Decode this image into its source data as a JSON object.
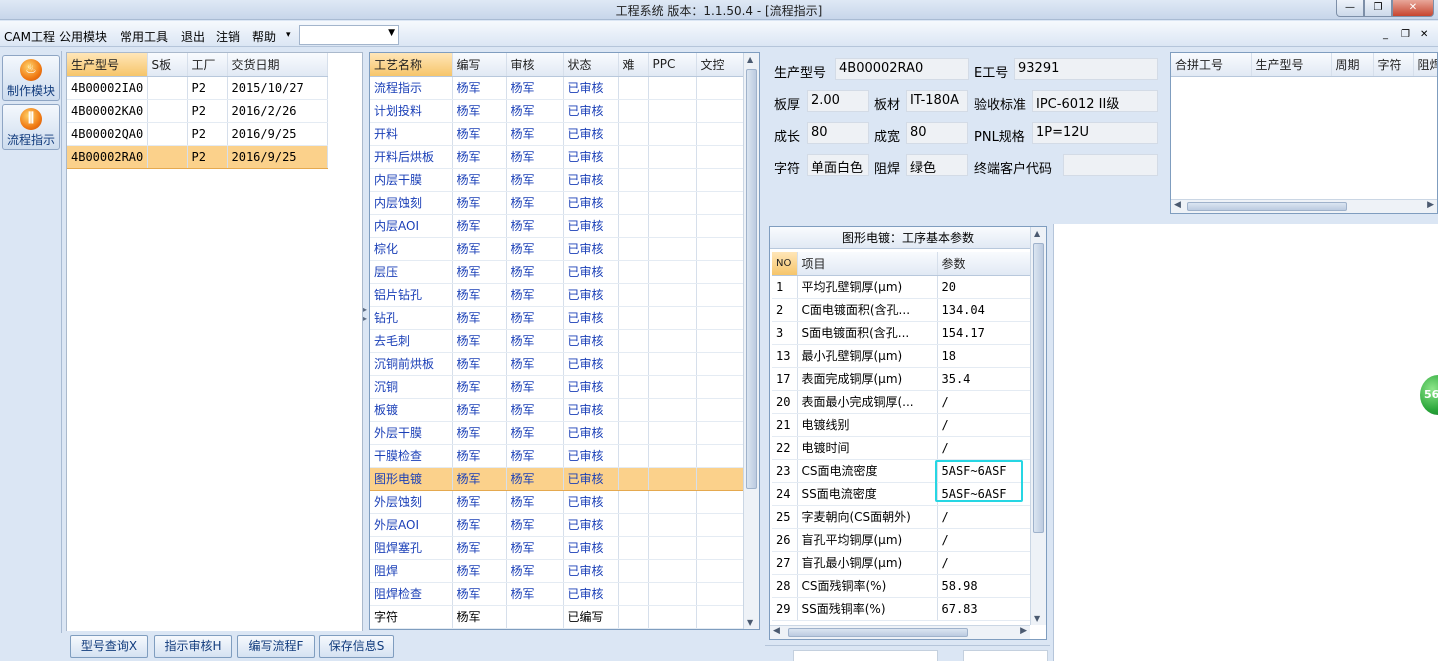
{
  "window": {
    "title": "工程系统   版本：1.1.50.4 - [流程指示]",
    "min": "—",
    "restore": "❐",
    "close": "✕"
  },
  "menu": {
    "items": [
      "CAM工程",
      "公用模块",
      "常用工具",
      "退出",
      "注销",
      "帮助"
    ],
    "combo_value": "",
    "mdi_min": "_",
    "mdi_restore": "❐",
    "mdi_close": "✕"
  },
  "nav": [
    {
      "label": "制作模块",
      "icon": "fire-icon",
      "glyph": "♨"
    },
    {
      "label": "流程指示",
      "icon": "flow-icon",
      "glyph": "⫼"
    }
  ],
  "models": {
    "headers": [
      "生产型号",
      "S板",
      "工厂",
      "交货日期"
    ],
    "rows": [
      {
        "model": "4B00002IA0",
        "s": "",
        "factory": "P2",
        "date": "2015/10/27"
      },
      {
        "model": "4B00002KA0",
        "s": "",
        "factory": "P2",
        "date": "2016/2/26"
      },
      {
        "model": "4B00002QA0",
        "s": "",
        "factory": "P2",
        "date": "2016/9/25"
      },
      {
        "model": "4B00002RA0",
        "s": "",
        "factory": "P2",
        "date": "2016/9/25"
      }
    ],
    "selected_index": 3
  },
  "process": {
    "headers": [
      "工艺名称",
      "编写",
      "审核",
      "状态",
      "难",
      "PPC",
      "文控"
    ],
    "rows": [
      {
        "name": "流程指示",
        "writer": "杨军",
        "reviewer": "杨军",
        "status": "已审核"
      },
      {
        "name": "计划投料",
        "writer": "杨军",
        "reviewer": "杨军",
        "status": "已审核"
      },
      {
        "name": "开料",
        "writer": "杨军",
        "reviewer": "杨军",
        "status": "已审核"
      },
      {
        "name": "开料后烘板",
        "writer": "杨军",
        "reviewer": "杨军",
        "status": "已审核"
      },
      {
        "name": "内层干膜",
        "writer": "杨军",
        "reviewer": "杨军",
        "status": "已审核"
      },
      {
        "name": "内层蚀刻",
        "writer": "杨军",
        "reviewer": "杨军",
        "status": "已审核"
      },
      {
        "name": "内层AOI",
        "writer": "杨军",
        "reviewer": "杨军",
        "status": "已审核"
      },
      {
        "name": "棕化",
        "writer": "杨军",
        "reviewer": "杨军",
        "status": "已审核"
      },
      {
        "name": "层压",
        "writer": "杨军",
        "reviewer": "杨军",
        "status": "已审核"
      },
      {
        "name": "铝片钻孔",
        "writer": "杨军",
        "reviewer": "杨军",
        "status": "已审核"
      },
      {
        "name": "钻孔",
        "writer": "杨军",
        "reviewer": "杨军",
        "status": "已审核"
      },
      {
        "name": "去毛刺",
        "writer": "杨军",
        "reviewer": "杨军",
        "status": "已审核"
      },
      {
        "name": "沉铜前烘板",
        "writer": "杨军",
        "reviewer": "杨军",
        "status": "已审核"
      },
      {
        "name": "沉铜",
        "writer": "杨军",
        "reviewer": "杨军",
        "status": "已审核"
      },
      {
        "name": "板镀",
        "writer": "杨军",
        "reviewer": "杨军",
        "status": "已审核"
      },
      {
        "name": "外层干膜",
        "writer": "杨军",
        "reviewer": "杨军",
        "status": "已审核"
      },
      {
        "name": "干膜检查",
        "writer": "杨军",
        "reviewer": "杨军",
        "status": "已审核"
      },
      {
        "name": "图形电镀",
        "writer": "杨军",
        "reviewer": "杨军",
        "status": "已审核"
      },
      {
        "name": "外层蚀刻",
        "writer": "杨军",
        "reviewer": "杨军",
        "status": "已审核"
      },
      {
        "name": "外层AOI",
        "writer": "杨军",
        "reviewer": "杨军",
        "status": "已审核"
      },
      {
        "name": "阻焊塞孔",
        "writer": "杨军",
        "reviewer": "杨军",
        "status": "已审核"
      },
      {
        "name": "阻焊",
        "writer": "杨军",
        "reviewer": "杨军",
        "status": "已审核"
      },
      {
        "name": "阻焊检查",
        "writer": "杨军",
        "reviewer": "杨军",
        "status": "已审核"
      },
      {
        "name": "字符",
        "writer": "杨军",
        "reviewer": "",
        "status": "已编写"
      }
    ],
    "selected_index": 17
  },
  "info": {
    "model_label": "生产型号",
    "model_value": "4B00002RA0",
    "eno_label": "E工号",
    "eno_value": "93291",
    "thick_label": "板厚",
    "thick_value": "2.00",
    "mat_label": "板材",
    "mat_value": "IT-180A",
    "std_label": "验收标准",
    "std_value": "IPC-6012 II级",
    "len_label": "成长",
    "len_value": "80",
    "wid_label": "成宽",
    "wid_value": "80",
    "pnl_label": "PNL规格",
    "pnl_value": "1P=12U",
    "char_label": "字符",
    "char_value": "单面白色",
    "mask_label": "阻焊",
    "mask_value": "绿色",
    "cust_label": "终端客户代码",
    "cust_value": ""
  },
  "combine": {
    "headers": [
      "合拼工号",
      "生产型号",
      "周期",
      "字符",
      "阻焊"
    ]
  },
  "params": {
    "title": "图形电镀：工序基本参数",
    "headers": [
      "NO",
      "项目",
      "参数"
    ],
    "rows": [
      {
        "no": "1",
        "item": "平均孔壁铜厚(μm)",
        "value": "20"
      },
      {
        "no": "2",
        "item": "C面电镀面积(含孔...",
        "value": "134.04"
      },
      {
        "no": "3",
        "item": "S面电镀面积(含孔...",
        "value": "154.17"
      },
      {
        "no": "13",
        "item": "最小孔壁铜厚(μm)",
        "value": "18"
      },
      {
        "no": "17",
        "item": "表面完成铜厚(μm)",
        "value": "35.4"
      },
      {
        "no": "20",
        "item": "表面最小完成铜厚(...",
        "value": "/"
      },
      {
        "no": "21",
        "item": "电镀线别",
        "value": "/"
      },
      {
        "no": "22",
        "item": "电镀时间",
        "value": "/"
      },
      {
        "no": "23",
        "item": "CS面电流密度",
        "value": "5ASF~6ASF"
      },
      {
        "no": "24",
        "item": "SS面电流密度",
        "value": "5ASF~6ASF"
      },
      {
        "no": "25",
        "item": "字麦朝向(CS面朝外)",
        "value": "/"
      },
      {
        "no": "26",
        "item": "盲孔平均铜厚(μm)",
        "value": "/"
      },
      {
        "no": "27",
        "item": "盲孔最小铜厚(μm)",
        "value": "/"
      },
      {
        "no": "28",
        "item": "CS面残铜率(%)",
        "value": "58.98"
      },
      {
        "no": "29",
        "item": "SS面残铜率(%)",
        "value": "67.83"
      }
    ]
  },
  "buttons": [
    "型号查询X",
    "指示审核H",
    "编写流程F",
    "保存信息S"
  ],
  "badge": "56",
  "colors": {
    "selection": "#fbd18b",
    "highlight": "#26d6e3",
    "link": "#1a3fb7"
  }
}
